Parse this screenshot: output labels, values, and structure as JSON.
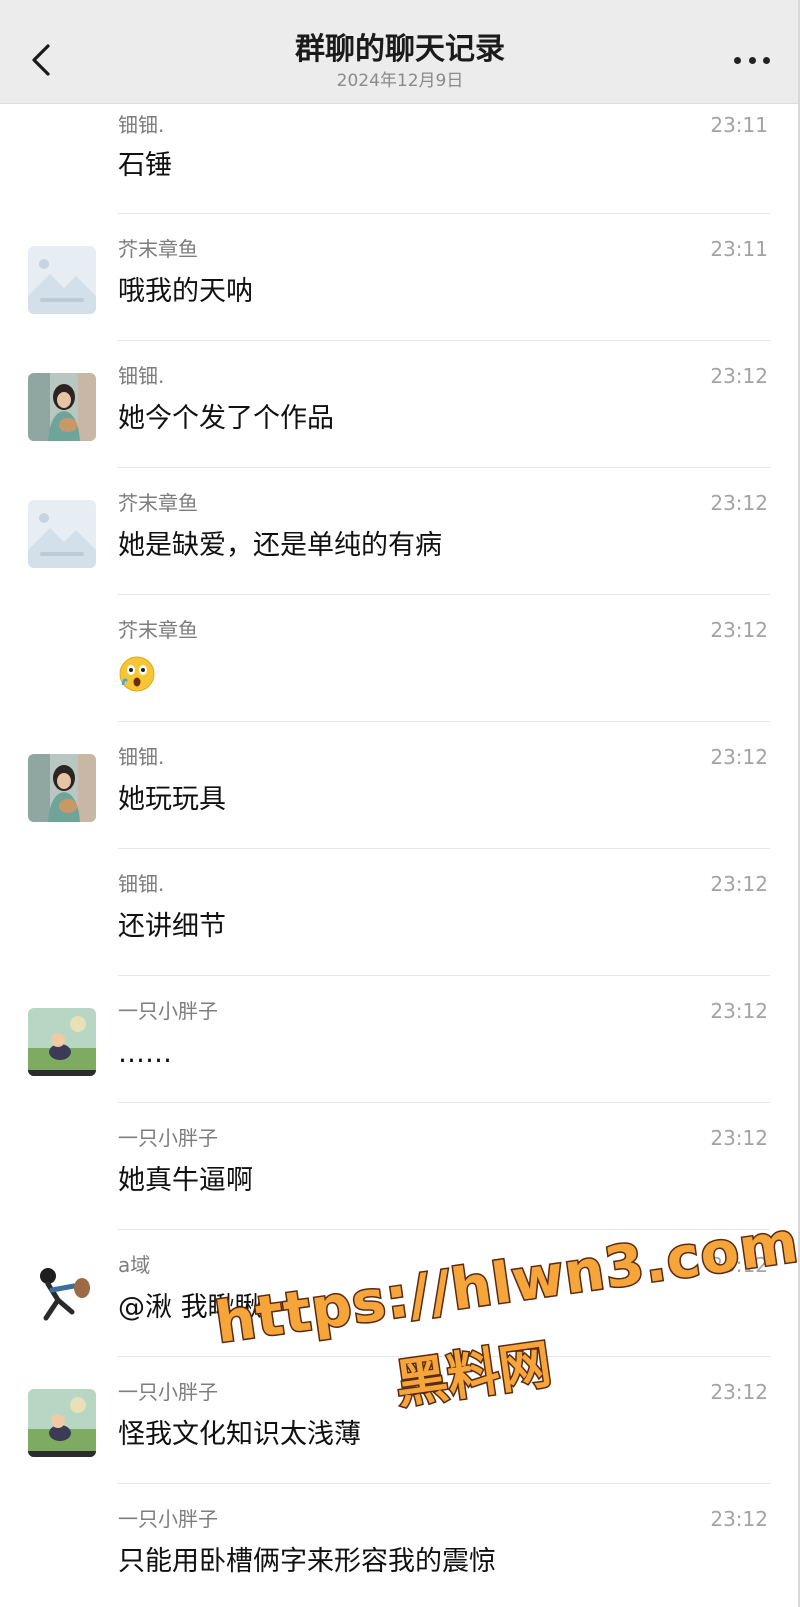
{
  "header": {
    "title": "群聊的聊天记录",
    "date": "2024年12月9日"
  },
  "messages": [
    {
      "sender": "钿钿.",
      "time": "23:11",
      "text": "石锤",
      "avatar": "none"
    },
    {
      "sender": "芥末章鱼",
      "time": "23:11",
      "text": "哦我的天呐",
      "avatar": "landscape-placeholder"
    },
    {
      "sender": "钿钿.",
      "time": "23:12",
      "text": "她今个发了个作品",
      "avatar": "girl-photo"
    },
    {
      "sender": "芥末章鱼",
      "time": "23:12",
      "text": "她是缺爱，还是单纯的有病",
      "avatar": "landscape-placeholder"
    },
    {
      "sender": "芥末章鱼",
      "time": "23:12",
      "text": "",
      "avatar": "none",
      "emoji": "shocked-face-emoji"
    },
    {
      "sender": "钿钿.",
      "time": "23:12",
      "text": "她玩玩具",
      "avatar": "girl-photo"
    },
    {
      "sender": "钿钿.",
      "time": "23:12",
      "text": "还讲细节",
      "avatar": "none"
    },
    {
      "sender": "一只小胖子",
      "time": "23:12",
      "text": "……",
      "avatar": "cartoon-scene"
    },
    {
      "sender": "一只小胖子",
      "time": "23:12",
      "text": "她真牛逼啊",
      "avatar": "none"
    },
    {
      "sender": "a域",
      "time": "23:12",
      "text": "@湫 我瞅瞅",
      "avatar": "running-figure"
    },
    {
      "sender": "一只小胖子",
      "time": "23:12",
      "text": "怪我文化知识太浅薄",
      "avatar": "cartoon-scene"
    },
    {
      "sender": "一只小胖子",
      "time": "23:12",
      "text": "只能用卧槽俩字来形容我的震惊",
      "avatar": "none"
    }
  ],
  "watermark": {
    "url": "https://hlwn3.com",
    "name": "黑料网"
  },
  "colors": {
    "nav_bg": "#ececec",
    "watermark_fill": "#f6a53a",
    "watermark_stroke": "#5a2a10"
  }
}
